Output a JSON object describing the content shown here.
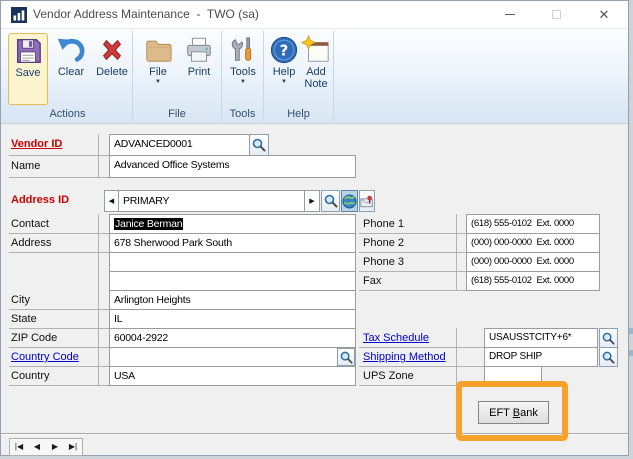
{
  "window": {
    "title": "Vendor Address Maintenance  -  TWO (sa)"
  },
  "ribbon": {
    "save": "Save",
    "clear": "Clear",
    "delete": "Delete",
    "file": "File",
    "print": "Print",
    "tools": "Tools",
    "help": "Help",
    "add_note": "Add Note",
    "groups": {
      "actions": "Actions",
      "file": "File",
      "tools": "Tools",
      "help": "Help"
    },
    "dropdown": "▼"
  },
  "form": {
    "vendor_id": {
      "label": "Vendor ID",
      "value": "ADVANCED0001"
    },
    "name": {
      "label": "Name",
      "value": "Advanced Office Systems"
    },
    "address_id": {
      "label": "Address ID",
      "value": "PRIMARY"
    },
    "contact": {
      "label": "Contact",
      "value": "Janice Berman"
    },
    "address": {
      "label": "Address",
      "line1": "678 Sherwood Park South",
      "line2": "",
      "line3": ""
    },
    "city": {
      "label": "City",
      "value": "Arlington Heights"
    },
    "state": {
      "label": "State",
      "value": "IL"
    },
    "zip": {
      "label": "ZIP Code",
      "value": "60004-2922"
    },
    "country_code": {
      "label": "Country Code",
      "value": ""
    },
    "country": {
      "label": "Country",
      "value": "USA"
    },
    "phone1": {
      "label": "Phone 1",
      "value": "(618) 555-0102  Ext. 0000"
    },
    "phone2": {
      "label": "Phone 2",
      "value": "(000) 000-0000  Ext. 0000"
    },
    "phone3": {
      "label": "Phone 3",
      "value": "(000) 000-0000  Ext. 0000"
    },
    "fax": {
      "label": "Fax",
      "value": "(618) 555-0102  Ext. 0000"
    },
    "tax_schedule": {
      "label": "Tax Schedule",
      "value": "USAUSSTCITY+6*"
    },
    "shipping_method": {
      "label": "Shipping Method",
      "value": "DROP SHIP"
    },
    "ups_zone": {
      "label": "UPS Zone",
      "value": ""
    }
  },
  "eft_button": {
    "pre": "EFT ",
    "key": "B",
    "post": "ank"
  },
  "nav": {
    "glyphs": [
      "|◀",
      "◀",
      "▶",
      "▶|"
    ]
  },
  "icons": {
    "left_arrow": "◀",
    "right_arrow": "▶"
  },
  "colors": {
    "annotation_highlight": "#F5A12B",
    "required_label": "#CC0000",
    "link_label": "#0000CC",
    "save_highlight_border": "#E2BD56"
  }
}
